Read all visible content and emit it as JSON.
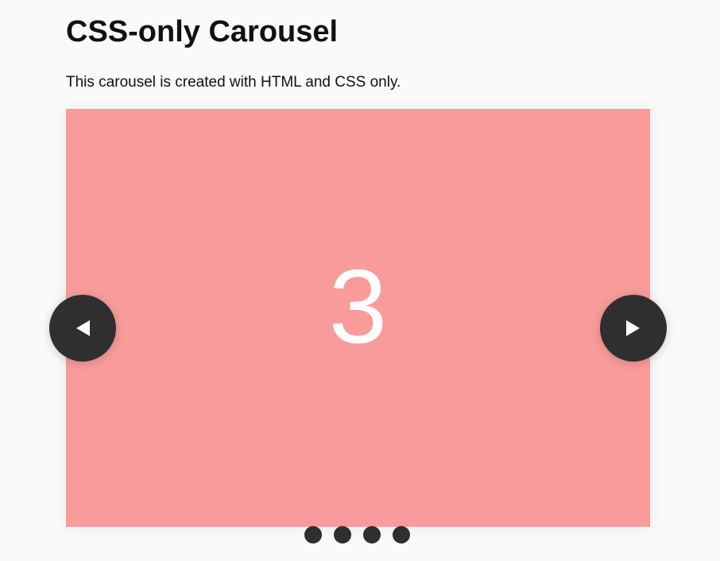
{
  "page": {
    "title": "CSS-only Carousel",
    "description": "This carousel is created with HTML and CSS only."
  },
  "carousel": {
    "current_slide_label": "3",
    "slide_background": "#f99b9b",
    "slide_text_color": "#ffffff",
    "control_color": "#2f2f2f",
    "controls": {
      "previous_icon": "triangle-left-icon",
      "next_icon": "triangle-right-icon"
    },
    "indicators_count": 4,
    "indicators": [
      {
        "slide": "1"
      },
      {
        "slide": "2"
      },
      {
        "slide": "3"
      },
      {
        "slide": "4"
      }
    ]
  }
}
